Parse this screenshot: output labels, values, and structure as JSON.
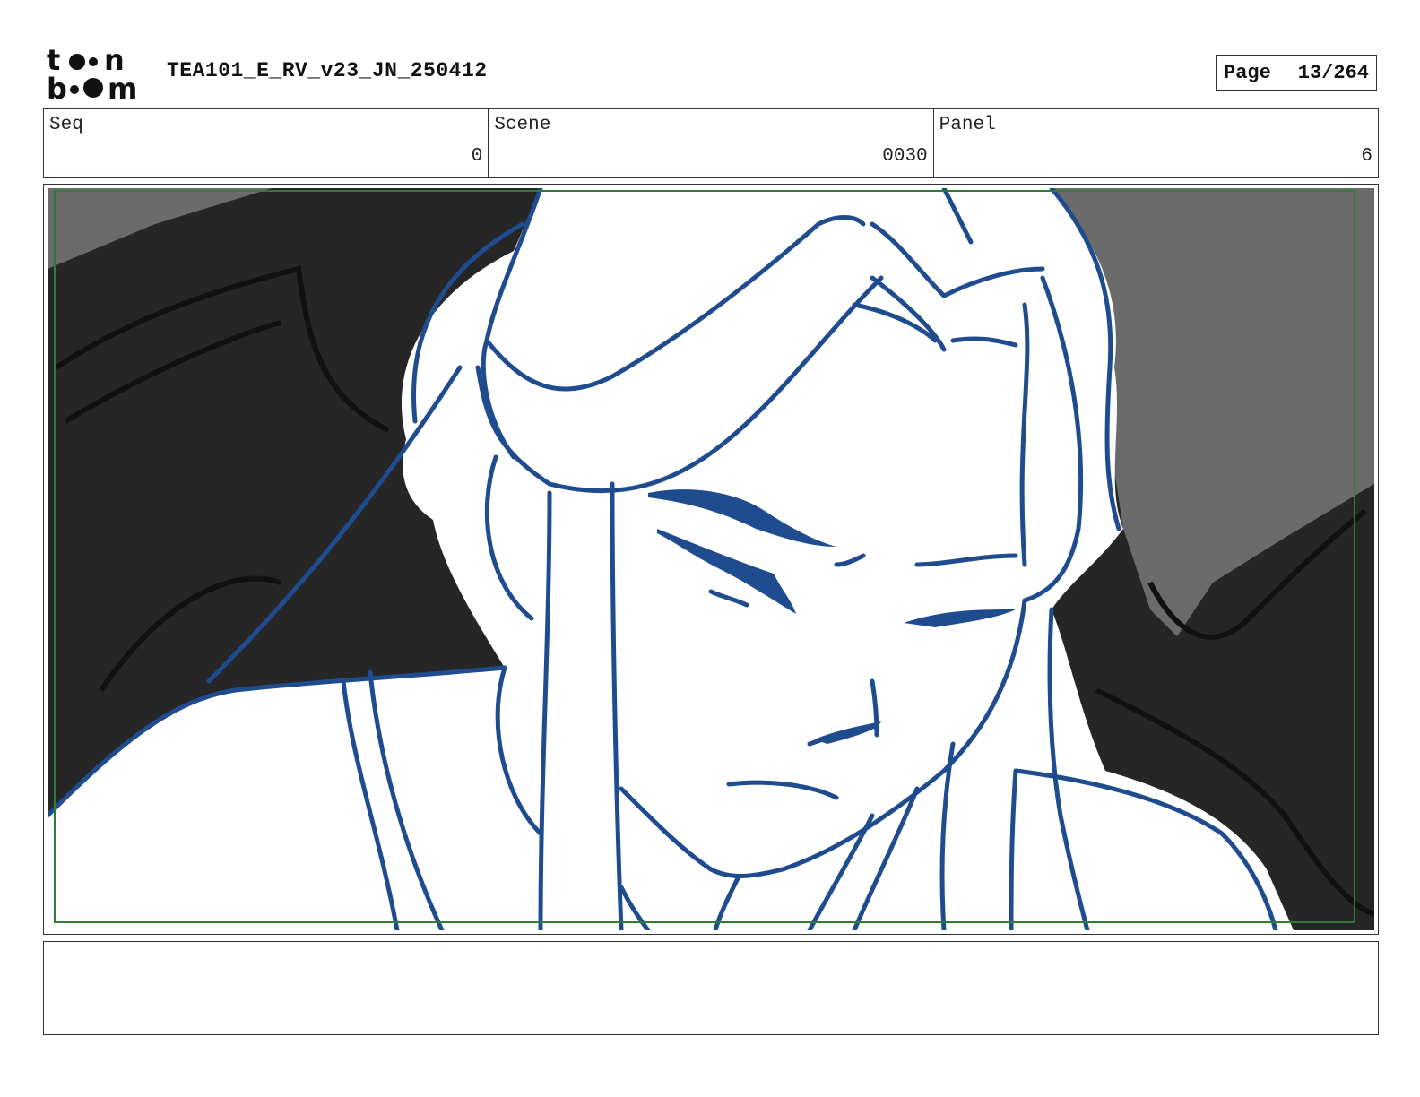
{
  "header": {
    "logo_text": "toon boom",
    "document_title": "TEA101_E_RV_v23_JN_250412",
    "page_label": "Page",
    "page_value": "13/264"
  },
  "info": {
    "seq_label": "Seq",
    "seq_value": "0",
    "scene_label": "Scene",
    "scene_value": "0030",
    "panel_label": "Panel",
    "panel_value": "6"
  },
  "colors": {
    "line_art": "#1f4c8f",
    "safe_frame": "#2e7d32",
    "background_dark": "#262626",
    "background_gray": "#6b6b6b"
  }
}
